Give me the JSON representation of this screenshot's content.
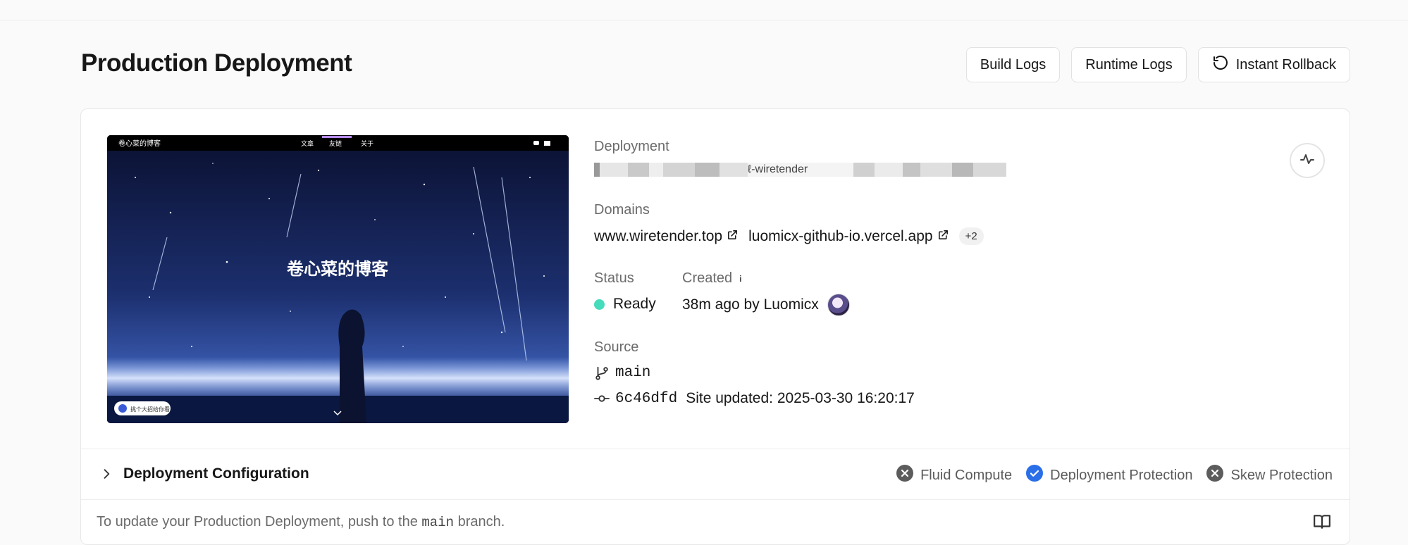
{
  "header": {
    "title": "Production Deployment",
    "buttons": {
      "build_logs": "Build Logs",
      "runtime_logs": "Runtime Logs",
      "instant_rollback": "Instant Rollback"
    }
  },
  "preview": {
    "site_name": "卷心菜的博客",
    "nav": [
      "文章",
      "友链",
      "关于"
    ],
    "hero_title": "卷心菜的博客",
    "music_label": "挑个大招给你看"
  },
  "deployment": {
    "label": "Deployment",
    "url_fragment": "ℓ-wiretender"
  },
  "domains": {
    "label": "Domains",
    "items": [
      "www.wiretender.top",
      "luomicx-github-io.vercel.app"
    ],
    "more": "+2"
  },
  "status": {
    "label": "Status",
    "value": "Ready",
    "color": "#45dcbb"
  },
  "created": {
    "label": "Created",
    "info_icon": "i",
    "value": "38m ago by Luomicx"
  },
  "source": {
    "label": "Source",
    "branch": "main",
    "commit_hash": "6c46dfd",
    "commit_message": "Site updated: 2025-03-30 16:20:17"
  },
  "configuration": {
    "title": "Deployment Configuration",
    "features": [
      {
        "label": "Fluid Compute",
        "enabled": false
      },
      {
        "label": "Deployment Protection",
        "enabled": true
      },
      {
        "label": "Skew Protection",
        "enabled": false
      }
    ]
  },
  "footer": {
    "text_before": "To update your Production Deployment, push to the ",
    "branch": "main",
    "text_after": " branch."
  },
  "colors": {
    "accent_blue": "#2a6ee8",
    "status_ready": "#45dcbb"
  }
}
